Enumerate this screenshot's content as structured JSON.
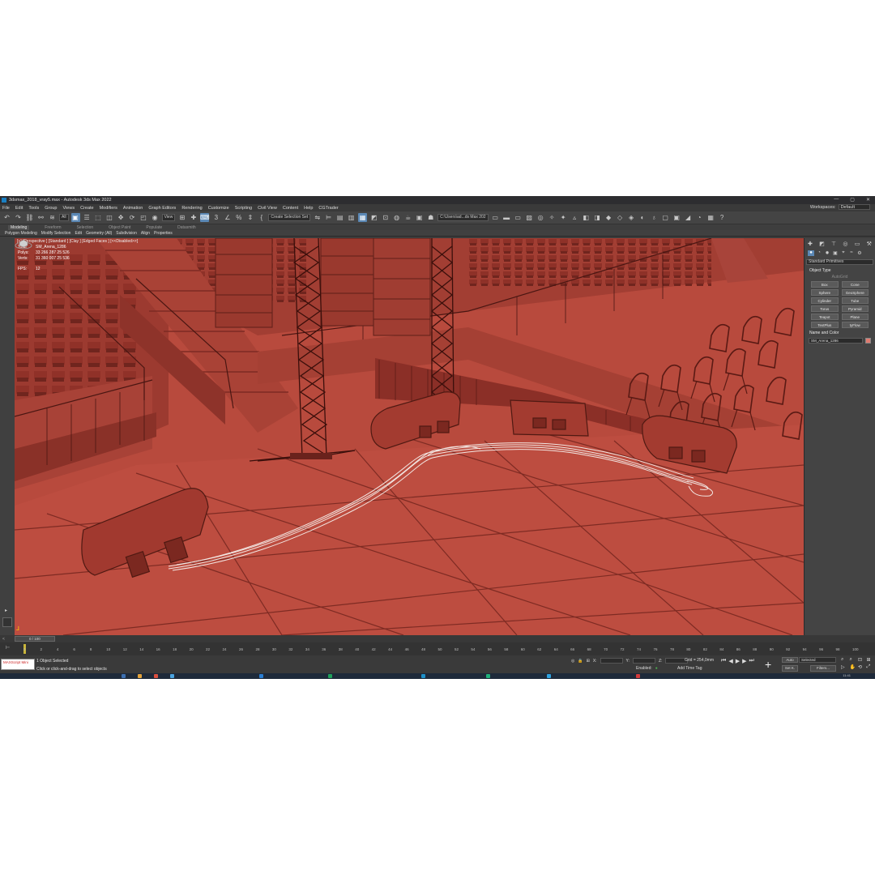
{
  "window": {
    "title": "3dsmax_2018_vray5.max - Autodesk 3ds Max 2022",
    "controls": [
      "—",
      "▢",
      "✕"
    ]
  },
  "menu": {
    "items": [
      "File",
      "Edit",
      "Tools",
      "Group",
      "Views",
      "Create",
      "Modifiers",
      "Animation",
      "Graph Editors",
      "Rendering",
      "Customize",
      "Scripting",
      "Civil View",
      "Content",
      "Help",
      "CGTrader"
    ],
    "workspaces_label": "Workspaces:",
    "workspaces_value": "Default"
  },
  "toolbar": {
    "filter_value": "All",
    "view_value": "View",
    "selection_set": "Create Selection Set",
    "project_path": "C:\\Users\\ad...ds Max 202"
  },
  "ribbon": {
    "tabs": [
      "Modeling",
      "Freeform",
      "Selection",
      "Object Paint",
      "Populate",
      "Datasmith"
    ],
    "active_tab": "Modeling",
    "subtabs": [
      "Polygon Modeling",
      "Modify Selection",
      "Edit",
      "Geometry (All)",
      "Subdivision",
      "Align",
      "Properties"
    ]
  },
  "viewport": {
    "label": "[+] [Perspective ] [Standard ] [Clay ] [Edged Faces ] [<<Disabled>>]",
    "stats": {
      "total_label": "Total",
      "total_value": "SM_Arena_1286",
      "polys_label": "Polys:",
      "polys_value": "33 266 287  25 526",
      "verts_label": "Verts:",
      "verts_value": "31 360 007  25 536",
      "fps_label": "FPS:",
      "fps_value": "12"
    },
    "background_color": "#b5473b"
  },
  "command_panel": {
    "category_dropdown": "Standard Primitives",
    "object_type_title": "Object Type",
    "autogrid_label": "AutoGrid",
    "primitives": [
      "Box",
      "Cone",
      "Sphere",
      "GeoSphere",
      "Cylinder",
      "Tube",
      "Torus",
      "Pyramid",
      "Teapot",
      "Plane",
      "TextPlus",
      "tyFlow"
    ],
    "name_and_color_title": "Name and Color",
    "object_name": "SM_Arena_1286",
    "object_color": "#e07b70"
  },
  "timeline": {
    "slider_label": "0 / 100",
    "frame_ticks": [
      0,
      2,
      4,
      6,
      8,
      10,
      12,
      14,
      16,
      18,
      20,
      22,
      24,
      26,
      28,
      30,
      32,
      34,
      36,
      38,
      40,
      42,
      44,
      46,
      48,
      50,
      52,
      54,
      56,
      58,
      60,
      62,
      64,
      66,
      68,
      70,
      72,
      74,
      76,
      78,
      80,
      82,
      84,
      86,
      88,
      90,
      92,
      94,
      96,
      98,
      100
    ]
  },
  "status": {
    "maxscript_text": "MAXScript Mini",
    "selection_text": "1 Object Selected",
    "prompt_text": "Click or click-and-drag to select objects",
    "x_label": "X:",
    "y_label": "Y:",
    "z_label": "Z:",
    "grid_text": "Grid = 254,0mm",
    "enabled_label": "Enabled:",
    "add_time_tag": "Add Time Tag",
    "auto_label": "Auto",
    "selected_value": "Selected",
    "setk_label": "Set K.",
    "filters_label": "Filters...",
    "clock": "11:41"
  }
}
